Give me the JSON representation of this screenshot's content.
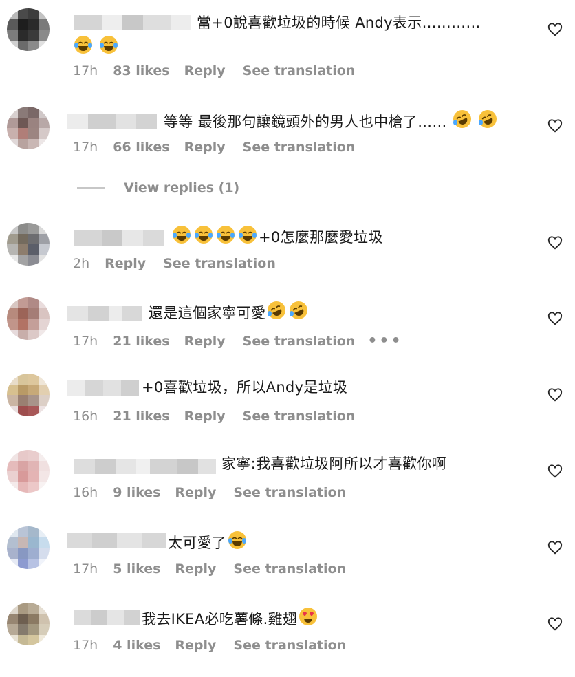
{
  "comments": [
    {
      "text_lines": [
        "當+0說喜歡垃圾的時候 Andy表示…………",
        ""
      ],
      "emojis_line2": [
        "joy",
        "joy"
      ],
      "time": "17h",
      "likes": "83 likes",
      "reply": "Reply",
      "translate": "See translation"
    },
    {
      "text_lines": [
        "等等 最後那句讓鏡頭外的男人也中槍了……"
      ],
      "emojis_end": [
        "rofl",
        "rofl"
      ],
      "time": "17h",
      "likes": "66 likes",
      "reply": "Reply",
      "translate": "See translation"
    },
    {
      "text_lines": [
        "+0怎麼那麼愛垃圾"
      ],
      "emojis_start": [
        "joy",
        "joy",
        "joy",
        "joy"
      ],
      "time": "2h",
      "likes": "",
      "reply": "Reply",
      "translate": "See translation"
    },
    {
      "text_lines": [
        "還是這個家寧可愛"
      ],
      "emojis_end": [
        "rofl",
        "rofl"
      ],
      "time": "17h",
      "likes": "21 likes",
      "reply": "Reply",
      "translate": "See translation",
      "more": "•••"
    },
    {
      "text_lines": [
        "+0喜歡垃圾，所以Andy是垃圾"
      ],
      "time": "16h",
      "likes": "21 likes",
      "reply": "Reply",
      "translate": "See translation"
    },
    {
      "text_lines": [
        "家寧:我喜歡垃圾阿所以才喜歡你啊"
      ],
      "time": "16h",
      "likes": "9 likes",
      "reply": "Reply",
      "translate": "See translation"
    },
    {
      "text_lines": [
        "太可愛了"
      ],
      "emojis_end": [
        "joy"
      ],
      "time": "17h",
      "likes": "5 likes",
      "reply": "Reply",
      "translate": "See translation"
    },
    {
      "text_lines": [
        "我去IKEA必吃薯條.雞翅"
      ],
      "emojis_end": [
        "heart-eyes"
      ],
      "time": "17h",
      "likes": "4 likes",
      "reply": "Reply",
      "translate": "See translation"
    }
  ],
  "view_replies": "View replies (1)",
  "icons": {
    "like": "heart-outline-icon"
  },
  "colors": {
    "meta": "#8e8e8e",
    "text": "#111111",
    "emoji_yellow": "#f8c13a"
  }
}
